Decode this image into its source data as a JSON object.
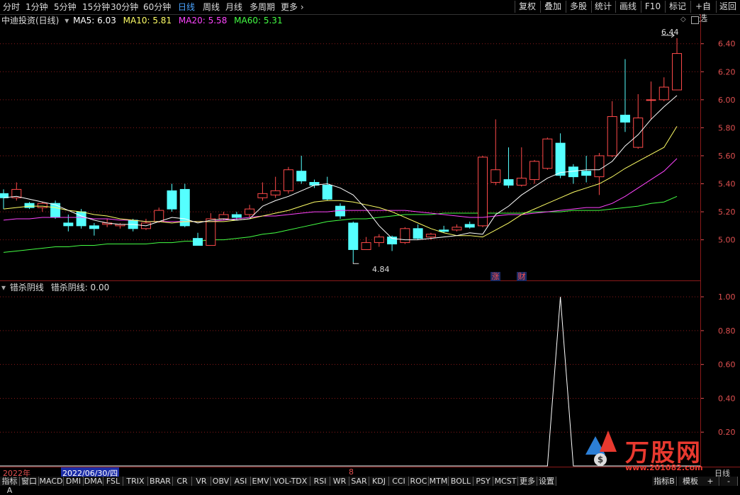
{
  "toolbar": {
    "periods": [
      "分时",
      "1分钟",
      "5分钟",
      "15分钟",
      "30分钟",
      "60分钟",
      "日线",
      "周线",
      "月线",
      "多周期",
      "更多"
    ],
    "active_period": "日线",
    "right_buttons": [
      "复权",
      "叠加",
      "多股",
      "统计",
      "画线",
      "F10",
      "标记",
      "+自选",
      "返回"
    ]
  },
  "main_legend": {
    "title": "中迪投资(日线)",
    "ma5": "MA5: 6.03",
    "ma10": "MA10: 5.81",
    "ma20": "MA20: 5.58",
    "ma60": "MA60: 5.31"
  },
  "sub_legend": {
    "name": "错杀阴线",
    "value": "错杀阴线: 0.00"
  },
  "price_axis": [
    "6.40",
    "6.20",
    "6.00",
    "5.80",
    "5.60",
    "5.40",
    "5.20",
    "5.00"
  ],
  "indicator_axis": [
    "1.00",
    "0.80",
    "0.60",
    "0.40",
    "0.20"
  ],
  "annotations": {
    "high": "6.44",
    "low": "4.84",
    "badge_zhang": "涨",
    "badge_cai": "财"
  },
  "date_bar": {
    "year": "2022年",
    "cursor_date": "2022/06/30/四",
    "month_mark": "8",
    "right_label": "日线"
  },
  "bottom_tabs": [
    "指标A",
    "窗口",
    "MACD",
    "DMI",
    "DMA",
    "FSL",
    "TRIX",
    "BRAR",
    "CR",
    "VR",
    "OBV",
    "ASI",
    "EMV",
    "VOL-TDX",
    "RSI",
    "WR",
    "SAR",
    "KDJ",
    "CCI",
    "ROC",
    "MTM",
    "BOLL",
    "PSY",
    "MCST",
    "更多",
    "设置"
  ],
  "bottom_right": [
    "指标B",
    "模板",
    "+",
    "-"
  ],
  "watermark": {
    "brand": "万股网",
    "url": "www.201082.com"
  },
  "colors": {
    "up": "#ff4a4a",
    "down": "#55ffff",
    "ma5": "#ffffff",
    "ma10": "#ffff66",
    "ma20": "#ff44ff",
    "ma60": "#44ff44",
    "grid": "#8b1a1a"
  },
  "chart_data": [
    {
      "type": "candlestick",
      "title": "中迪投资(日线)",
      "ylim": [
        4.72,
        6.52
      ],
      "candles": [
        {
          "o": 5.33,
          "c": 5.3,
          "h": 5.36,
          "l": 5.22
        },
        {
          "o": 5.3,
          "c": 5.36,
          "h": 5.41,
          "l": 5.28
        },
        {
          "o": 5.26,
          "c": 5.23,
          "h": 5.27,
          "l": 5.22
        },
        {
          "o": 5.23,
          "c": 5.26,
          "h": 5.27,
          "l": 5.2
        },
        {
          "o": 5.26,
          "c": 5.16,
          "h": 5.28,
          "l": 5.15
        },
        {
          "o": 5.12,
          "c": 5.1,
          "h": 5.18,
          "l": 5.06
        },
        {
          "o": 5.2,
          "c": 5.1,
          "h": 5.22,
          "l": 5.08
        },
        {
          "o": 5.1,
          "c": 5.08,
          "h": 5.12,
          "l": 5.03
        },
        {
          "o": 5.11,
          "c": 5.12,
          "h": 5.15,
          "l": 5.09
        },
        {
          "o": 5.1,
          "c": 5.11,
          "h": 5.12,
          "l": 5.08
        },
        {
          "o": 5.14,
          "c": 5.08,
          "h": 5.15,
          "l": 5.06
        },
        {
          "o": 5.08,
          "c": 5.12,
          "h": 5.15,
          "l": 5.07
        },
        {
          "o": 5.13,
          "c": 5.21,
          "h": 5.23,
          "l": 5.12
        },
        {
          "o": 5.35,
          "c": 5.22,
          "h": 5.4,
          "l": 5.2
        },
        {
          "o": 5.36,
          "c": 5.1,
          "h": 5.4,
          "l": 5.09
        },
        {
          "o": 5.01,
          "c": 4.96,
          "h": 5.05,
          "l": 4.96
        },
        {
          "o": 4.96,
          "c": 5.15,
          "h": 5.19,
          "l": 4.96
        },
        {
          "o": 5.15,
          "c": 5.18,
          "h": 5.2,
          "l": 5.14
        },
        {
          "o": 5.18,
          "c": 5.16,
          "h": 5.2,
          "l": 5.14
        },
        {
          "o": 5.18,
          "c": 5.22,
          "h": 5.25,
          "l": 5.16
        },
        {
          "o": 5.3,
          "c": 5.33,
          "h": 5.41,
          "l": 5.28
        },
        {
          "o": 5.32,
          "c": 5.35,
          "h": 5.45,
          "l": 5.3
        },
        {
          "o": 5.35,
          "c": 5.5,
          "h": 5.52,
          "l": 5.33
        },
        {
          "o": 5.49,
          "c": 5.42,
          "h": 5.6,
          "l": 5.4
        },
        {
          "o": 5.41,
          "c": 5.39,
          "h": 5.43,
          "l": 5.37
        },
        {
          "o": 5.39,
          "c": 5.29,
          "h": 5.45,
          "l": 5.28
        },
        {
          "o": 5.24,
          "c": 5.17,
          "h": 5.26,
          "l": 5.15
        },
        {
          "o": 5.12,
          "c": 4.93,
          "h": 5.13,
          "l": 4.84
        },
        {
          "o": 4.93,
          "c": 4.98,
          "h": 5.02,
          "l": 4.93
        },
        {
          "o": 4.98,
          "c": 5.02,
          "h": 5.04,
          "l": 4.95
        },
        {
          "o": 5.02,
          "c": 4.97,
          "h": 5.03,
          "l": 4.92
        },
        {
          "o": 4.98,
          "c": 5.08,
          "h": 5.09,
          "l": 4.97
        },
        {
          "o": 5.08,
          "c": 5.01,
          "h": 5.11,
          "l": 5.0
        },
        {
          "o": 5.02,
          "c": 5.04,
          "h": 5.05,
          "l": 5.0
        },
        {
          "o": 5.07,
          "c": 5.06,
          "h": 5.1,
          "l": 5.05
        },
        {
          "o": 5.07,
          "c": 5.09,
          "h": 5.11,
          "l": 5.06
        },
        {
          "o": 5.11,
          "c": 5.09,
          "h": 5.13,
          "l": 5.08
        },
        {
          "o": 5.1,
          "c": 5.59,
          "h": 5.6,
          "l": 5.09
        },
        {
          "o": 5.41,
          "c": 5.5,
          "h": 5.86,
          "l": 5.39
        },
        {
          "o": 5.43,
          "c": 5.39,
          "h": 5.66,
          "l": 5.37
        },
        {
          "o": 5.39,
          "c": 5.44,
          "h": 5.66,
          "l": 5.38
        },
        {
          "o": 5.43,
          "c": 5.56,
          "h": 5.57,
          "l": 5.4
        },
        {
          "o": 5.51,
          "c": 5.72,
          "h": 5.73,
          "l": 5.5
        },
        {
          "o": 5.69,
          "c": 5.46,
          "h": 5.76,
          "l": 5.44
        },
        {
          "o": 5.52,
          "c": 5.45,
          "h": 5.54,
          "l": 5.4
        },
        {
          "o": 5.49,
          "c": 5.46,
          "h": 5.6,
          "l": 5.41
        },
        {
          "o": 5.45,
          "c": 5.6,
          "h": 5.62,
          "l": 5.32
        },
        {
          "o": 5.6,
          "c": 5.88,
          "h": 5.99,
          "l": 5.59
        },
        {
          "o": 5.89,
          "c": 5.84,
          "h": 6.29,
          "l": 5.77
        },
        {
          "o": 5.66,
          "c": 5.87,
          "h": 6.04,
          "l": 5.65
        },
        {
          "o": 6.0,
          "c": 6.0,
          "h": 6.13,
          "l": 5.86
        },
        {
          "o": 6.0,
          "c": 6.09,
          "h": 6.16,
          "l": 5.99
        },
        {
          "o": 6.07,
          "c": 6.33,
          "h": 6.44,
          "l": 6.07
        }
      ],
      "ma5": [
        5.3,
        5.31,
        5.29,
        5.27,
        5.25,
        5.21,
        5.17,
        5.14,
        5.12,
        5.11,
        5.11,
        5.1,
        5.13,
        5.16,
        5.15,
        5.12,
        5.14,
        5.15,
        5.14,
        5.15,
        5.24,
        5.28,
        5.31,
        5.35,
        5.39,
        5.4,
        5.37,
        5.32,
        5.22,
        5.1,
        5.01,
        5.0,
        5.0,
        5.01,
        5.02,
        5.03,
        5.05,
        5.04,
        5.18,
        5.24,
        5.32,
        5.38,
        5.44,
        5.48,
        5.49,
        5.5,
        5.5,
        5.56,
        5.67,
        5.75,
        5.86,
        5.95,
        6.03
      ],
      "ma10": [
        5.22,
        5.23,
        5.24,
        5.24,
        5.23,
        5.21,
        5.2,
        5.18,
        5.17,
        5.15,
        5.14,
        5.13,
        5.13,
        5.12,
        5.13,
        5.13,
        5.13,
        5.13,
        5.14,
        5.15,
        5.17,
        5.19,
        5.21,
        5.24,
        5.27,
        5.28,
        5.28,
        5.27,
        5.25,
        5.23,
        5.2,
        5.16,
        5.12,
        5.08,
        5.05,
        5.03,
        5.03,
        5.02,
        5.07,
        5.12,
        5.18,
        5.22,
        5.26,
        5.3,
        5.34,
        5.37,
        5.4,
        5.45,
        5.51,
        5.56,
        5.61,
        5.66,
        5.81
      ],
      "ma20": [
        5.14,
        5.15,
        5.15,
        5.16,
        5.16,
        5.16,
        5.16,
        5.15,
        5.15,
        5.14,
        5.14,
        5.13,
        5.13,
        5.13,
        5.13,
        5.13,
        5.13,
        5.14,
        5.15,
        5.16,
        5.17,
        5.17,
        5.18,
        5.19,
        5.2,
        5.2,
        5.21,
        5.21,
        5.21,
        5.21,
        5.21,
        5.21,
        5.2,
        5.19,
        5.18,
        5.17,
        5.16,
        5.16,
        5.17,
        5.18,
        5.18,
        5.19,
        5.2,
        5.21,
        5.22,
        5.23,
        5.23,
        5.26,
        5.31,
        5.37,
        5.43,
        5.49,
        5.58
      ],
      "ma60": [
        4.91,
        4.92,
        4.93,
        4.94,
        4.95,
        4.95,
        4.96,
        4.96,
        4.97,
        4.97,
        4.97,
        4.97,
        4.98,
        4.98,
        4.99,
        4.99,
        5.0,
        5.0,
        5.01,
        5.02,
        5.04,
        5.05,
        5.07,
        5.09,
        5.11,
        5.13,
        5.14,
        5.15,
        5.15,
        5.16,
        5.17,
        5.18,
        5.18,
        5.18,
        5.19,
        5.19,
        5.19,
        5.19,
        5.19,
        5.19,
        5.19,
        5.2,
        5.2,
        5.2,
        5.21,
        5.21,
        5.21,
        5.22,
        5.23,
        5.24,
        5.26,
        5.27,
        5.31
      ]
    },
    {
      "type": "line",
      "title": "错杀阴线",
      "ylim": [
        0,
        1.08
      ],
      "values": [
        0,
        0,
        0,
        0,
        0,
        0,
        0,
        0,
        0,
        0,
        0,
        0,
        0,
        0,
        0,
        0,
        0,
        0,
        0,
        0,
        0,
        0,
        0,
        0,
        0,
        0,
        0,
        0,
        0,
        0,
        0,
        0,
        0,
        0,
        0,
        0,
        0,
        0,
        0,
        0,
        0,
        0,
        0,
        1,
        0,
        0,
        0,
        0,
        0,
        0,
        0,
        0,
        0
      ]
    }
  ]
}
